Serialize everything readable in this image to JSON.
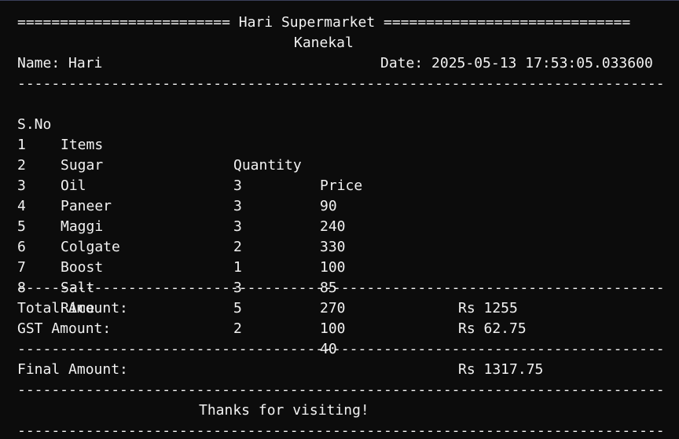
{
  "header": {
    "banner": "========================= Hari Supermarket =============================",
    "location": "Kanekal",
    "name_line": "Name: Hari",
    "date_line": "Date: 2025-05-13 17:53:05.033600"
  },
  "rule": "-----------------------------------------------------------------------------",
  "table": {
    "headers": [
      "S.No",
      "Items",
      "Quantity",
      "Price"
    ],
    "rows": [
      [
        "1",
        "Sugar",
        "3",
        "90"
      ],
      [
        "2",
        "Oil",
        "3",
        "240"
      ],
      [
        "3",
        "Paneer",
        "3",
        "330"
      ],
      [
        "4",
        "Maggi",
        "2",
        "100"
      ],
      [
        "5",
        "Colgate",
        "1",
        "85"
      ],
      [
        "6",
        "Boost",
        "3",
        "270"
      ],
      [
        "7",
        "Salt",
        "5",
        "100"
      ],
      [
        "8",
        "Rice",
        "2",
        "40"
      ]
    ]
  },
  "totals": {
    "total_label": "Total Amount:",
    "total_value": "Rs 1255",
    "gst_label": "GST Amount:",
    "gst_value": "Rs 62.75",
    "final_label": "Final Amount:",
    "final_value": "Rs 1317.75"
  },
  "footer": {
    "thanks": "Thanks for visiting!"
  }
}
